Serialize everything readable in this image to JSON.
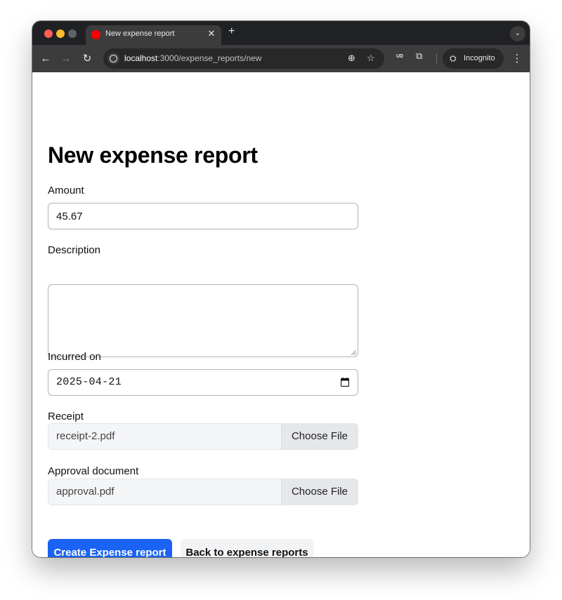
{
  "browser": {
    "tab": {
      "title": "New expense report",
      "close_glyph": "✕"
    },
    "new_tab_glyph": "+",
    "tab_search_glyph": "⌄",
    "toolbar": {
      "back_glyph": "←",
      "forward_glyph": "→",
      "reload_glyph": "↻"
    },
    "url": {
      "host": "localhost",
      "rest": ":3000/expense_reports/new"
    },
    "zoom_glyph": "⊕",
    "bookmark_glyph": "☆",
    "extension_ud_glyph": "UD",
    "extensions_glyph": "⧉",
    "incognito_label": "Incognito",
    "incognito_glyph": "⛭",
    "menu_glyph": "⋮",
    "colors": {
      "tabstrip": "#202124",
      "toolbar": "#3c3c3c",
      "favicon": "#ff0000"
    }
  },
  "page": {
    "title": "New expense report",
    "fields": {
      "amount": {
        "label": "Amount",
        "value": "45.67"
      },
      "description": {
        "label": "Description",
        "value": ""
      },
      "incurred_on": {
        "label": "Incurred on",
        "value": "2025-04-21"
      },
      "receipt": {
        "label": "Receipt",
        "file_name": "receipt-2.pdf",
        "button_label": "Choose File"
      },
      "approval_document": {
        "label": "Approval document",
        "file_name": "approval.pdf",
        "button_label": "Choose File"
      }
    },
    "actions": {
      "submit_label": "Create Expense report",
      "back_label": "Back to expense reports"
    },
    "colors": {
      "primary_button": "#1a63f5",
      "secondary_button": "#f2f3f5"
    }
  }
}
